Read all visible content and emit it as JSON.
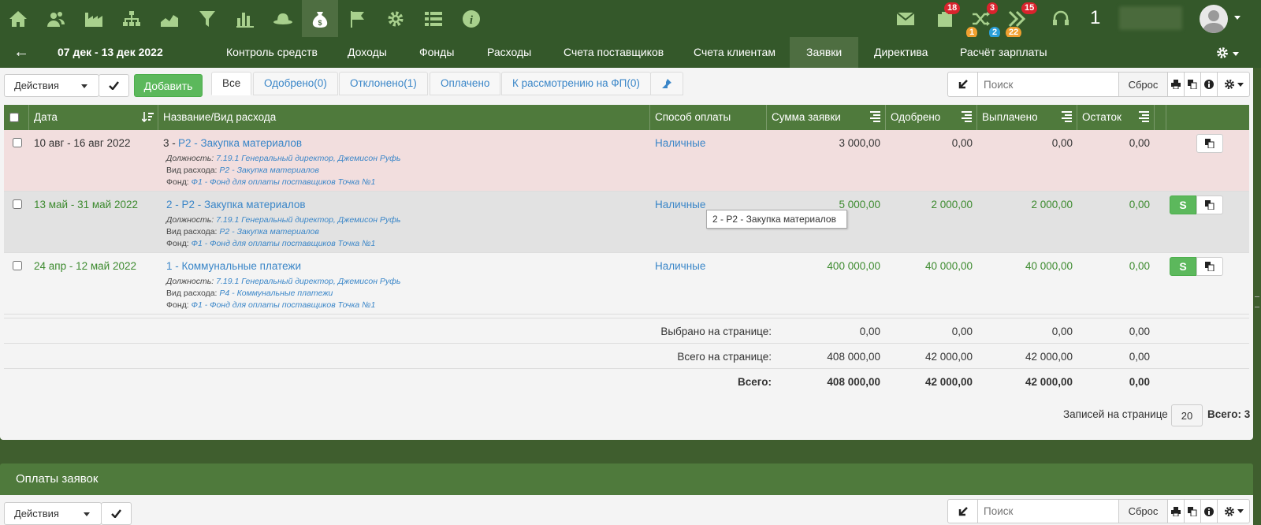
{
  "topbar": {
    "badges": {
      "bag": "18",
      "shuffle": "3",
      "forward": "15",
      "sub1": "1",
      "sub2": "2",
      "sub3": "22"
    },
    "counter": "1",
    "user_name_blurred": "",
    "icons": [
      "home-icon",
      "users-icon",
      "factory-icon",
      "hierarchy-icon",
      "area-chart-icon",
      "filter-icon",
      "bar-chart-icon",
      "hat-icon",
      "money-bag-icon",
      "flag-icon",
      "gear-icon",
      "list-icon",
      "info-icon"
    ]
  },
  "nav": {
    "back": "←",
    "date_range": "07 дек - 13 дек 2022",
    "links": [
      "Контроль средств",
      "Доходы",
      "Фонды",
      "Расходы",
      "Счета поставщиков",
      "Счета клиентам",
      "Заявки",
      "Директива",
      "Расчёт зарплаты"
    ]
  },
  "toolbar": {
    "actions": "Действия",
    "add": "Добавить",
    "search_placeholder": "Поиск",
    "reset": "Сброс"
  },
  "tabs": [
    "Все",
    "Одобрено(0)",
    "Отклонено(1)",
    "Оплачено",
    "К рассмотрению на ФП(0)"
  ],
  "table": {
    "headers": [
      "Дата",
      "Название/Вид расхода",
      "Способ оплаты",
      "Сумма заявки",
      "Одобрено",
      "Выплачено",
      "Остаток"
    ],
    "labels": {
      "position": "Должность:",
      "type": "Вид расхода:",
      "fund": "Фонд:"
    },
    "rows": [
      {
        "date": "10 авг - 16 авг 2022",
        "num": "3 - ",
        "title": "P2 - Закупка материалов",
        "position": "7.19.1 Генеральный директор, Джемисон Руфь",
        "type": "P2 - Закупка материалов",
        "fund": "Ф1 - Фонд для оплаты поставщиков Точка №1",
        "pay": "Наличные",
        "amount": "3 000,00",
        "approved": "0,00",
        "paid": "0,00",
        "rest": "0,00"
      },
      {
        "date": "13 май - 31 май 2022",
        "num": "",
        "title": "2 - P2 - Закупка материалов",
        "position": "7.19.1 Генеральный директор, Джемисон Руфь",
        "type": "P2 - Закупка материалов",
        "fund": "Ф1 - Фонд для оплаты поставщиков Точка №1",
        "pay": "Наличные",
        "amount": "5 000,00",
        "approved": "2 000,00",
        "paid": "2 000,00",
        "rest": "0,00",
        "s": "S"
      },
      {
        "date": "24 апр - 12 май 2022",
        "num": "",
        "title": "1 - Коммунальные платежи",
        "position": "7.19.1 Генеральный директор, Джемисон Руфь",
        "type": "P4 - Коммунальные платежи",
        "fund": "Ф1 - Фонд для оплаты поставщиков Точка №1",
        "pay": "Наличные",
        "amount": "400 000,00",
        "approved": "40 000,00",
        "paid": "40 000,00",
        "rest": "0,00",
        "s": "S"
      }
    ],
    "tooltip": "2 - P2 - Закупка материалов",
    "summary": [
      {
        "label": "Выбрано на странице:",
        "amount": "0,00",
        "approved": "0,00",
        "paid": "0,00",
        "rest": "0,00"
      },
      {
        "label": "Всего на странице:",
        "amount": "408 000,00",
        "approved": "42 000,00",
        "paid": "42 000,00",
        "rest": "0,00"
      },
      {
        "label": "Всего:",
        "amount": "408 000,00",
        "approved": "42 000,00",
        "paid": "42 000,00",
        "rest": "0,00"
      }
    ]
  },
  "pagination": {
    "label": "Записей на странице",
    "per_page": "20",
    "total": "Всего: 3"
  },
  "payments": {
    "title": "Оплаты заявок"
  },
  "colors": {
    "dark_green": "#34582a",
    "header_green": "#4f7a3c",
    "link_blue": "#3a86c8",
    "value_green": "#3c8a2e",
    "row_pink": "#f2dede"
  }
}
